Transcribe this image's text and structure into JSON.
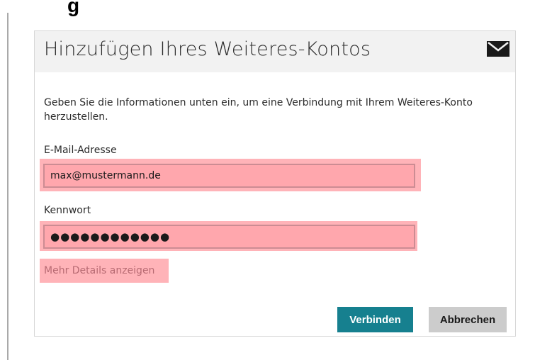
{
  "top_fragment": "g",
  "dialog": {
    "title": "Hinzufügen Ihres Weiteres-Kontos",
    "icon": "mail-icon",
    "description": "Geben Sie die Informationen unten ein, um eine Verbindung mit Ihrem Weiteres-Konto herzustellen.",
    "email_label": "E-Mail-Adresse",
    "email_value": "max@mustermann.de",
    "password_label": "Kennwort",
    "password_value": "●●●●●●●●●●●●",
    "more_details_link": "Mehr Details anzeigen",
    "connect_button": "Verbinden",
    "cancel_button": "Abbrechen"
  },
  "colors": {
    "accent": "#16808f",
    "highlight": "#ffb3b8",
    "header_bg": "#f2f2f2",
    "secondary_button": "#cccccc"
  }
}
